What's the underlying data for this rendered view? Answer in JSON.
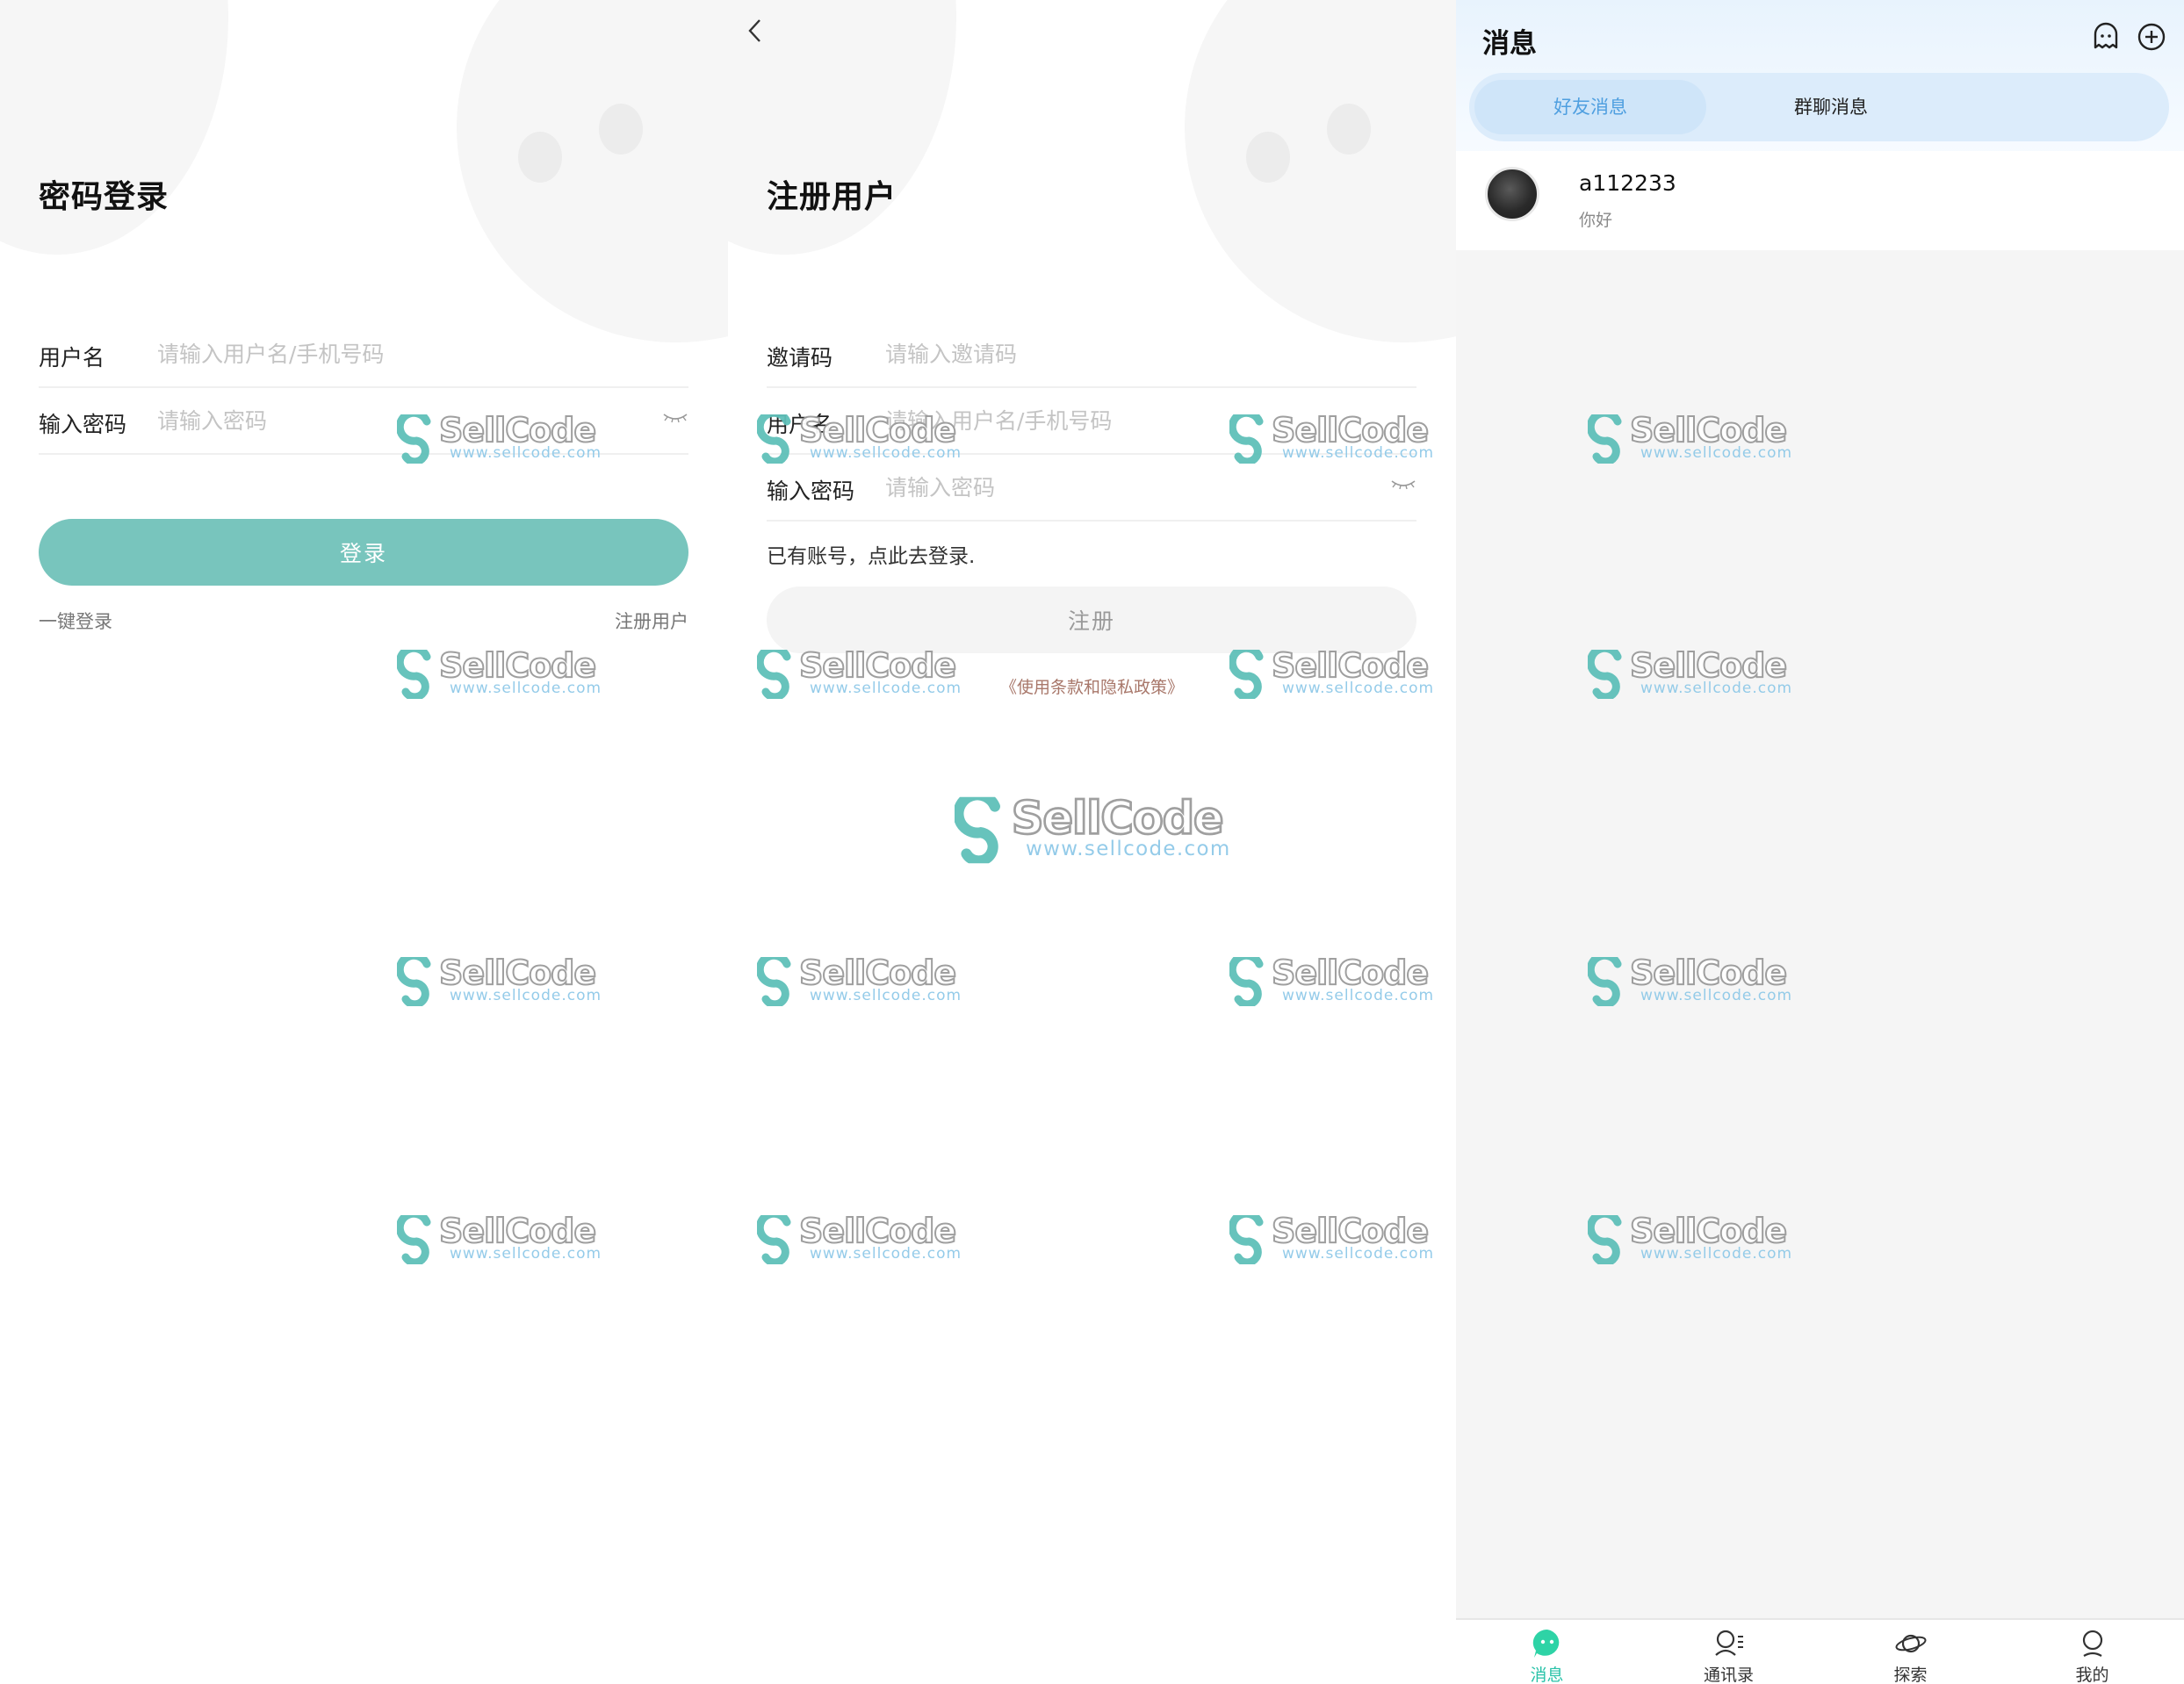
{
  "login": {
    "title": "密码登录",
    "username_label": "用户名",
    "username_placeholder": "请输入用户名/手机号码",
    "password_label": "输入密码",
    "password_placeholder": "请输入密码",
    "login_button": "登录",
    "one_click_login": "一键登录",
    "register_link": "注册用户"
  },
  "register": {
    "title": "注册用户",
    "invite_label": "邀请码",
    "invite_placeholder": "请输入邀请码",
    "username_label": "用户名",
    "username_placeholder": "请输入用户名/手机号码",
    "password_label": "输入密码",
    "password_placeholder": "请输入密码",
    "login_hint": "已有账号，点此去登录.",
    "register_button": "注册",
    "policy_link": "《使用条款和隐私政策》"
  },
  "messages": {
    "title": "消息",
    "tabs": [
      "好友消息",
      "群聊消息"
    ],
    "chats": [
      {
        "name": "a112233",
        "last_message": "你好"
      }
    ],
    "tabbar": [
      "消息",
      "通讯录",
      "探索",
      "我的"
    ],
    "accent_color": "#28c2a8",
    "tab_active_color": "#4f9fe0"
  },
  "watermark": {
    "brand": "SellCode",
    "url": "www.sellcode.com"
  }
}
